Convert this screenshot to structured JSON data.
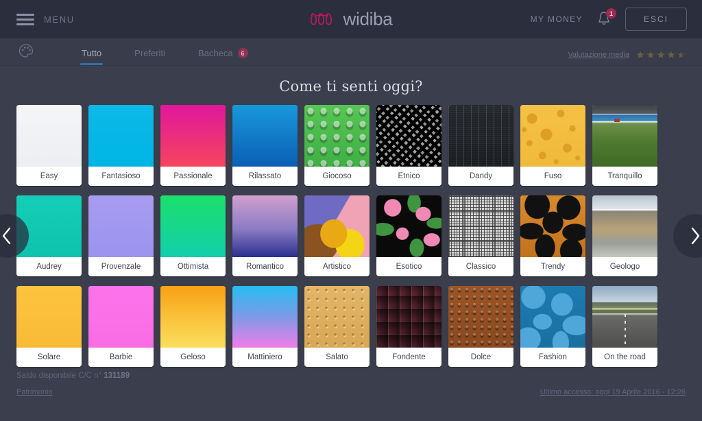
{
  "header": {
    "menu_label": "MENU",
    "menu_icon": "hamburger-icon",
    "brand": "widiba",
    "brand_mark_icon": "widiba-script-logo",
    "my_money_label": "MY MONEY",
    "bell_icon": "bell-icon",
    "bell_badge_count": "1",
    "logout_label": "ESCI"
  },
  "tabbar": {
    "palette_icon": "palette-icon",
    "tabs": [
      {
        "label": "Tutto",
        "active": true,
        "badge": ""
      },
      {
        "label": "Preferiti",
        "active": false,
        "badge": ""
      },
      {
        "label": "Bacheca",
        "active": false,
        "badge": "6"
      }
    ],
    "rating_label": "Valutazione media",
    "rating_value": "4.5",
    "rating_max": "5",
    "star_icon": "star-icon"
  },
  "main": {
    "title": "Come ti senti oggi?",
    "prev_icon": "chevron-left-icon",
    "next_icon": "chevron-right-icon",
    "rows": [
      [
        {
          "label": "Easy",
          "swatch": "sw-easy"
        },
        {
          "label": "Fantasioso",
          "swatch": "sw-fantasioso"
        },
        {
          "label": "Passionale",
          "swatch": "sw-passionale"
        },
        {
          "label": "Rilassato",
          "swatch": "sw-rilassato"
        },
        {
          "label": "Giocoso",
          "swatch": "sw-giocoso"
        },
        {
          "label": "Etnico",
          "swatch": "sw-etnico"
        },
        {
          "label": "Dandy",
          "swatch": "sw-dandy"
        },
        {
          "label": "Fuso",
          "swatch": "sw-fuso"
        },
        {
          "label": "Tranquillo",
          "swatch": "sw-tranquillo"
        }
      ],
      [
        {
          "label": "Audrey",
          "swatch": "sw-audrey"
        },
        {
          "label": "Provenzale",
          "swatch": "sw-provenzale"
        },
        {
          "label": "Ottimista",
          "swatch": "sw-ottimista"
        },
        {
          "label": "Romantico",
          "swatch": "sw-romantico"
        },
        {
          "label": "Artistico",
          "swatch": "sw-artistico"
        },
        {
          "label": "Esotico",
          "swatch": "sw-esotico"
        },
        {
          "label": "Classico",
          "swatch": "sw-classico"
        },
        {
          "label": "Trendy",
          "swatch": "sw-trendy"
        },
        {
          "label": "Geologo",
          "swatch": "sw-geologo"
        }
      ],
      [
        {
          "label": "Solare",
          "swatch": "sw-solare"
        },
        {
          "label": "Barbie",
          "swatch": "sw-barbie"
        },
        {
          "label": "Geloso",
          "swatch": "sw-geloso"
        },
        {
          "label": "Mattiniero",
          "swatch": "sw-mattiniero"
        },
        {
          "label": "Salato",
          "swatch": "sw-salato"
        },
        {
          "label": "Fondente",
          "swatch": "sw-fondente"
        },
        {
          "label": "Dolce",
          "swatch": "sw-dolce"
        },
        {
          "label": "Fashion",
          "swatch": "sw-fashion"
        },
        {
          "label": "On the road",
          "swatch": "sw-ontheroad"
        }
      ]
    ]
  },
  "footer": {
    "balance_label": "Saldo disponibile C/C n° ",
    "balance_account": "131189",
    "patrimonio_label": "Patrimonio",
    "last_access": "Ultimo accesso: oggi 19 Aprile 2016 - 12:26"
  },
  "colors": {
    "header_bg": "#2b2f3d",
    "tabbar_bg": "#393d4b",
    "page_bg": "#3b3f4d",
    "accent_blue": "#2f6fa8",
    "brand_pink": "#c2185b",
    "badge_red": "#9e2b4e"
  }
}
